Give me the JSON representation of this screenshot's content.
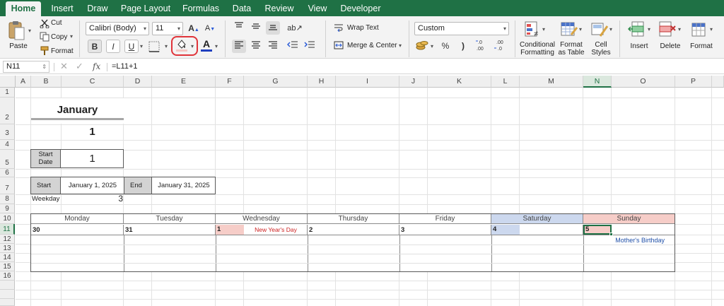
{
  "tabs": [
    "Home",
    "Insert",
    "Draw",
    "Page Layout",
    "Formulas",
    "Data",
    "Review",
    "View",
    "Developer"
  ],
  "active_tab": "Home",
  "ribbon": {
    "paste": "Paste",
    "cut": "Cut",
    "copy": "Copy",
    "format_painter": "Format",
    "font_name": "Calibri (Body)",
    "font_size": "11",
    "bold": "B",
    "italic": "I",
    "underline": "U",
    "font_grow": "A",
    "font_shrink": "A",
    "font_color_letter": "A",
    "wrap_text": "Wrap Text",
    "merge_center": "Merge & Center",
    "number_format": "Custom",
    "percent": "%",
    "comma": ")",
    "conditional_formatting_1": "Conditional",
    "conditional_formatting_2": "Formatting",
    "format_as_table_1": "Format",
    "format_as_table_2": "as Table",
    "cell_styles_1": "Cell",
    "cell_styles_2": "Styles",
    "insert": "Insert",
    "delete": "Delete",
    "format": "Format",
    "colors": {
      "accent": "#1f7145",
      "highlight_circle": "#e0343a",
      "font_color_bar": "#1f3fbf",
      "fill_bar": "#f4c7c3"
    }
  },
  "formula_bar": {
    "name_box": "N11",
    "fx": "fx",
    "formula": "=L11+1"
  },
  "columns": [
    "A",
    "B",
    "C",
    "D",
    "E",
    "F",
    "G",
    "H",
    "I",
    "J",
    "K",
    "L",
    "M",
    "N",
    "O",
    "P"
  ],
  "rows": [
    "1",
    "2",
    "3",
    "4",
    "5",
    "6",
    "7",
    "8",
    "9",
    "10",
    "11",
    "12",
    "13",
    "14",
    "15",
    "16"
  ],
  "selected_column": "N",
  "selected_row": "11",
  "sheet": {
    "month_title": "January",
    "month_number": "1",
    "start_date_label_1": "Start",
    "start_date_label_2": "Date",
    "start_date_value": "1",
    "start_label": "Start",
    "start_value": "January 1, 2025",
    "end_label": "End",
    "end_value": "January 31, 2025",
    "weekday_label": "Weekday",
    "weekday_value": "3",
    "days": [
      "Monday",
      "Tuesday",
      "Wednesday",
      "Thursday",
      "Friday",
      "Saturday",
      "Sunday"
    ],
    "day_numbers": [
      "30",
      "31",
      "1",
      "2",
      "3",
      "4",
      "5"
    ],
    "new_years": "New Year's Day",
    "mothers_birthday": "Mother's Birthday",
    "colors": {
      "saturday": "#ccd8ee",
      "sunday": "#f6cdc8",
      "holiday_red": "#cc1f1f",
      "event_blue": "#1f4fa8",
      "gray": "#d3d3d3"
    }
  }
}
